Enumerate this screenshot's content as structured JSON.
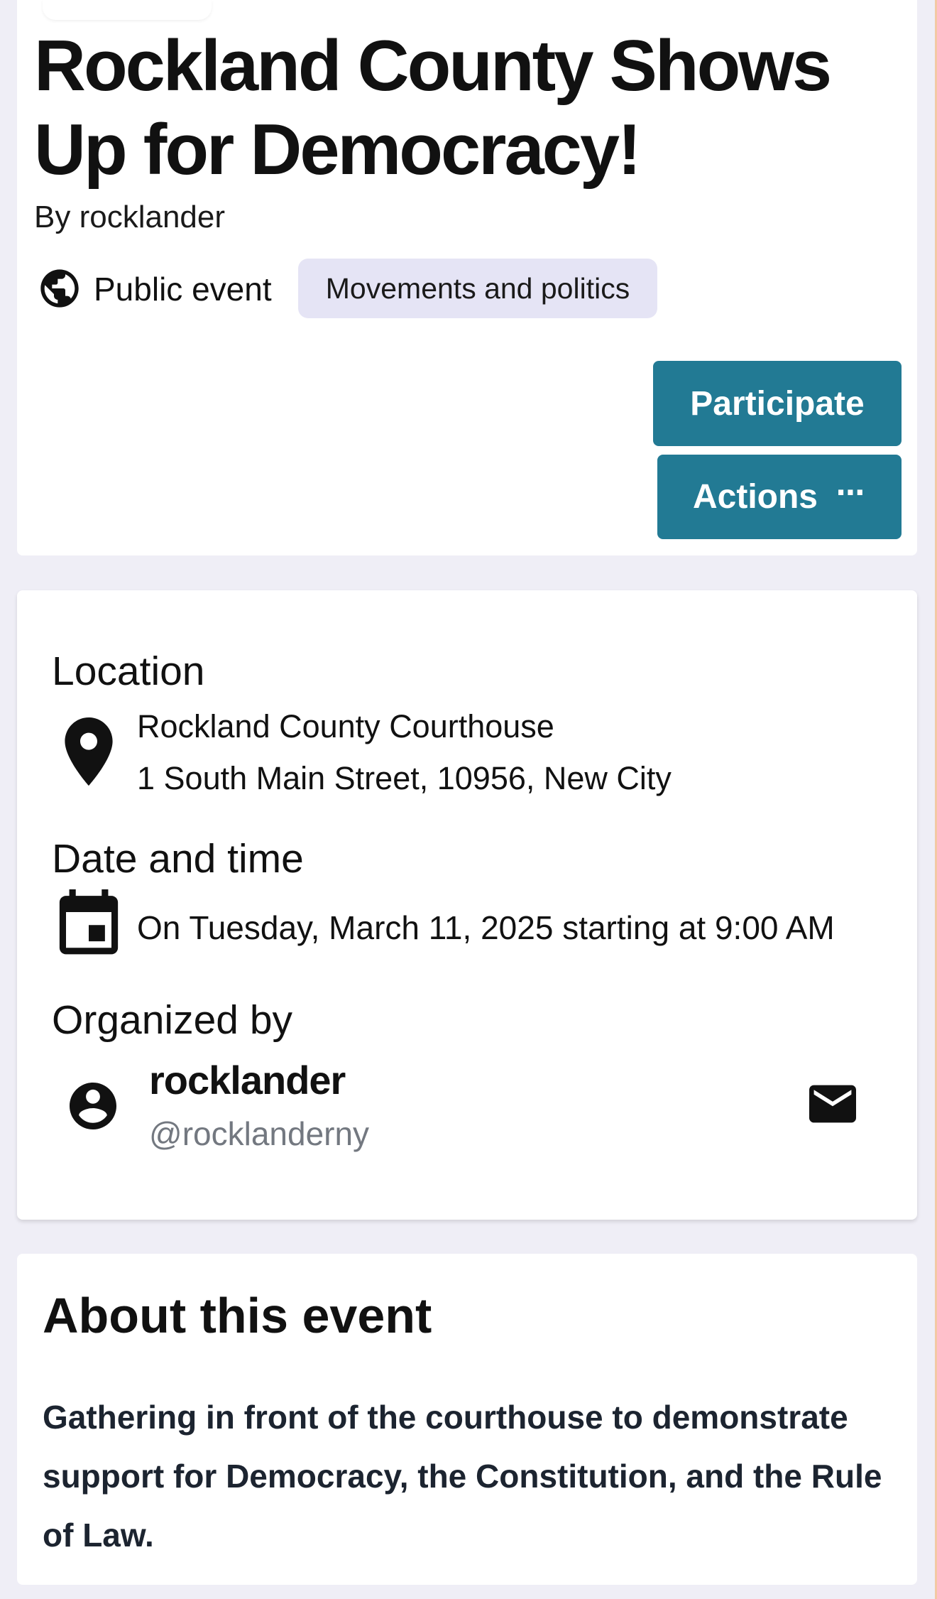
{
  "event": {
    "title": "Rockland County Shows Up for Democracy!",
    "byline": "By rocklander",
    "visibility": "Public event",
    "category": "Movements and politics"
  },
  "buttons": {
    "participate": "Participate",
    "actions": "Actions",
    "actions_dots": "⋯"
  },
  "info": {
    "location_label": "Location",
    "location_name": "Rockland County Courthouse",
    "location_address": "1 South Main Street, 10956, New City",
    "date_label": "Date and time",
    "date_text": "On Tuesday, March 11, 2025 starting at 9:00 AM",
    "organizer_label": "Organized by",
    "organizer_name": "rocklander",
    "organizer_handle": "@rocklanderny"
  },
  "about": {
    "title": "About this event",
    "description": "Gathering in front of the courthouse to demonstrate support for Democracy, the Constitution, and the Rule of Law."
  },
  "icons": {
    "visibility": "globe-icon",
    "location": "map-pin-icon",
    "date": "calendar-icon",
    "organizer": "account-circle-icon",
    "contact": "mail-icon"
  },
  "colors": {
    "button": "#227a94",
    "tag_bg": "#e5e4f5",
    "page_bg": "#efeef6",
    "handle": "#737880"
  }
}
